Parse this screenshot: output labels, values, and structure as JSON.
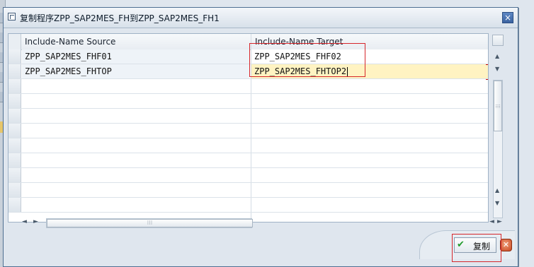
{
  "dialog": {
    "title": "复制程序ZPP_SAP2MES_FH到ZPP_SAP2MES_FH1",
    "close_label": "×"
  },
  "table": {
    "columns": [
      "Include-Name Source",
      "Include-Name Target"
    ],
    "rows": [
      {
        "source": "ZPP_SAP2MES_FHF01",
        "target": "ZPP_SAP2MES_FHF02"
      },
      {
        "source": "ZPP_SAP2MES_FHTOP",
        "target": "ZPP_SAP2MES_FHTOP2"
      }
    ],
    "empty_row_count": 9
  },
  "scroll": {
    "left_arrow": "◄",
    "right_arrow": "►",
    "up_arrow": "▲",
    "down_arrow": "▼",
    "grip": "⁝⁝⁝"
  },
  "footer": {
    "copy_label": "复制",
    "copy_icon": "✔",
    "cancel_icon": "✕"
  },
  "colors": {
    "active_cell": "#fff3c2",
    "highlight_box": "#d6262b",
    "check_green": "#1f9a2a"
  }
}
